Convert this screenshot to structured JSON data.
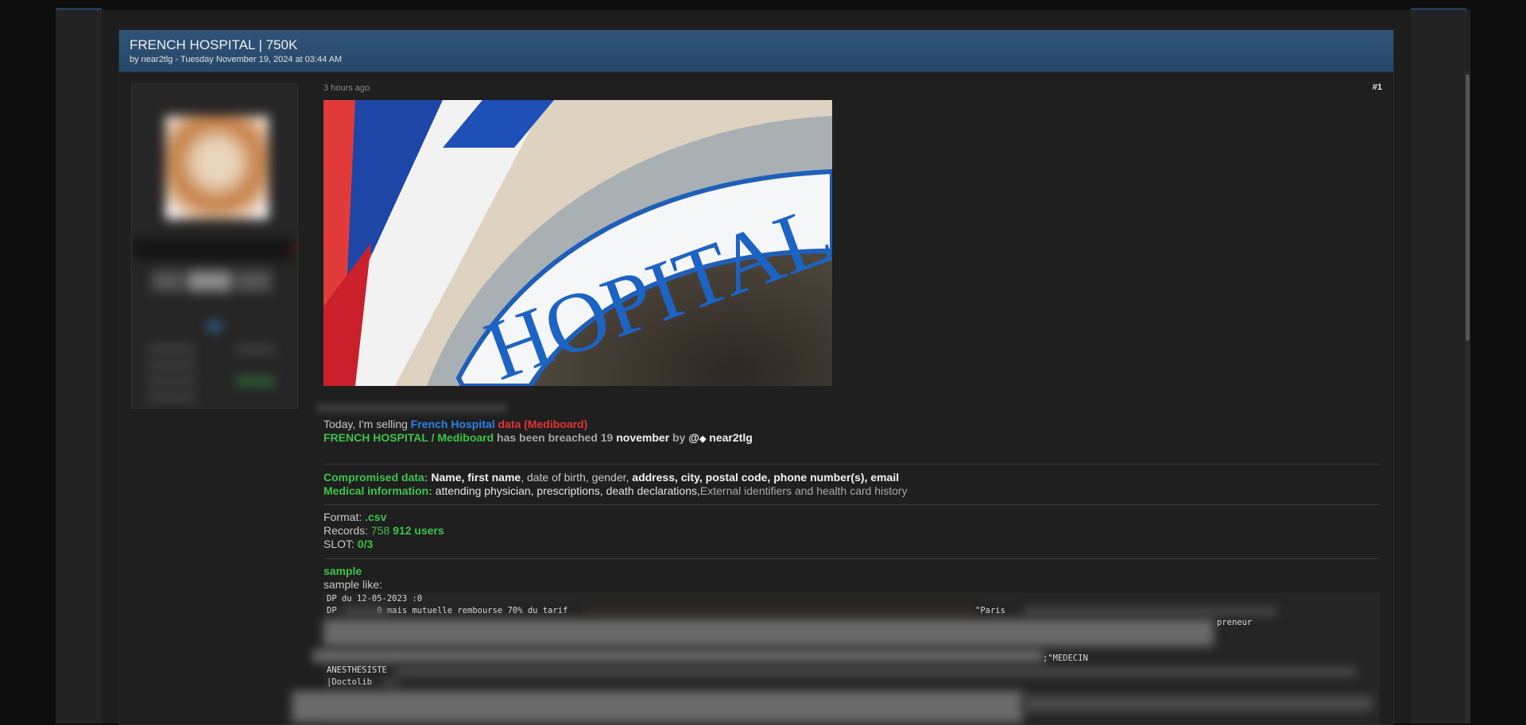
{
  "thread": {
    "title": "FRENCH HOSPITAL | 750K",
    "meta": "by near2tlg - Tuesday November 19, 2024 at 03:44 AM"
  },
  "post": {
    "time_ago": "3 hours ago",
    "number": "#1",
    "image_sign_text": "HOPITAL",
    "line1": {
      "prefix": "Today, I'm selling ",
      "entity": "French Hospital",
      "suffix": " data (Mediboard)"
    },
    "line2": {
      "entity": "FRENCH HOSPITAL / Mediboard",
      "middle": " has been breached 19 ",
      "month": "november",
      "by": " by ",
      "handle_prefix": "@",
      "handle": " near2tlg"
    },
    "compromised": {
      "label": "Compromised data:",
      "bold1": " Name, first name",
      "plain1": ", date of birth, gender, ",
      "bold2": "address, city, postal code, phone number(s), email"
    },
    "medical": {
      "label": "Medical information:",
      "plain": " attending physician, prescriptions, death declarations,",
      "grey": "External identifiers and health card history"
    },
    "format": {
      "label": "Format: ",
      "value": ".csv"
    },
    "records": {
      "label": "Records: ",
      "num": "758",
      "rest": " 912 users"
    },
    "slot": {
      "label": "SLOT: ",
      "value": "0/3"
    },
    "sample_heading": "sample",
    "sample_like": "sample like:",
    "code_lines": [
      "DP du 12-05-2023 :0",
      "DP        0 mais mutuelle rembourse 70% du tarif",
      "\"Paris",
      "preneur",
      ";\"MEDECIN",
      "ANESTHESISTE",
      "|Doctolib"
    ]
  },
  "colors": {
    "header_blue": "#2f5477",
    "accent_green": "#3ec44a",
    "accent_blue": "#2f80ea",
    "accent_red": "#e33434"
  }
}
